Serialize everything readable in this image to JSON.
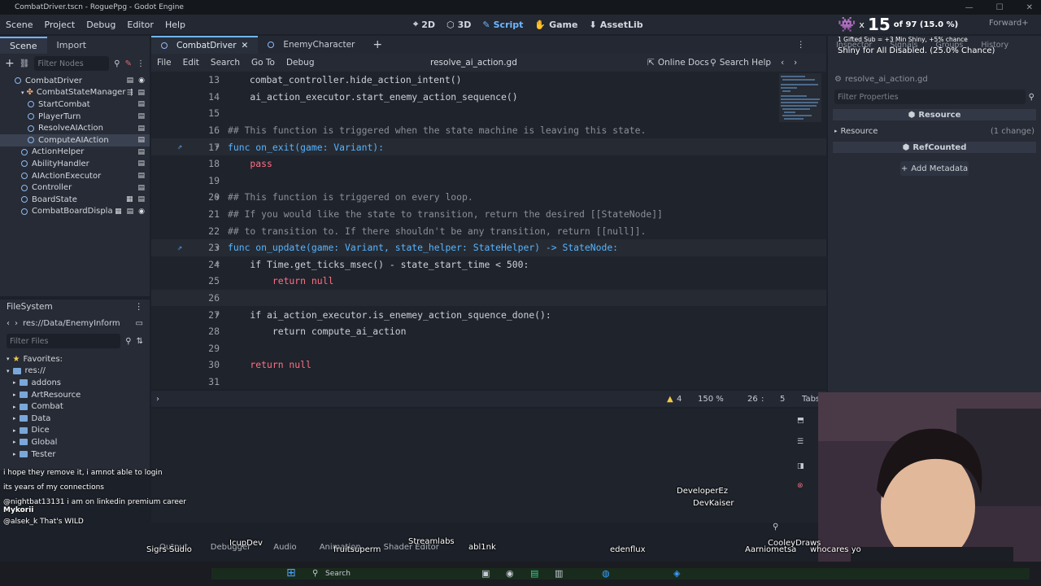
{
  "window": {
    "title": "CombatDriver.tscn - RoguePpg - Godot Engine"
  },
  "menubar": {
    "items": [
      "Scene",
      "Project",
      "Debug",
      "Editor",
      "Help"
    ],
    "modes": [
      "2D",
      "3D",
      "Script",
      "Game",
      "AssetLib"
    ],
    "renderer": "Forward+"
  },
  "scene_dock": {
    "tabs": [
      "Scene",
      "Import"
    ],
    "filter_placeholder": "Filter Nodes",
    "nodes": [
      {
        "label": "CombatDriver"
      },
      {
        "label": "CombatStateManager"
      },
      {
        "label": "StartCombat"
      },
      {
        "label": "PlayerTurn"
      },
      {
        "label": "ResolveAIAction"
      },
      {
        "label": "ComputeAIAction"
      },
      {
        "label": "ActionHelper"
      },
      {
        "label": "AbilityHandler"
      },
      {
        "label": "AIActionExecutor"
      },
      {
        "label": "Controller"
      },
      {
        "label": "BoardState"
      },
      {
        "label": "CombatBoardDispla"
      }
    ]
  },
  "filesystem": {
    "title": "FileSystem",
    "path": "res://Data/EnemyInform",
    "filter_placeholder": "Filter Files",
    "favorites_label": "Favorites:",
    "root": "res://",
    "folders": [
      "addons",
      "ArtResource",
      "Combat",
      "Data",
      "Dice",
      "Global",
      "Tester"
    ]
  },
  "editor": {
    "tabs": [
      "CombatDriver",
      "EnemyCharacter"
    ],
    "menu": [
      "File",
      "Edit",
      "Search",
      "Go To",
      "Debug"
    ],
    "script_name": "resolve_ai_action.gd",
    "online_docs": "Online Docs",
    "search_help": "Search Help",
    "lines": [
      {
        "n": "13",
        "text": "    combat_controller.hide_action_intent()"
      },
      {
        "n": "14",
        "text": "    ai_action_executor.start_enemy_action_sequence()"
      },
      {
        "n": "15",
        "text": ""
      },
      {
        "n": "16",
        "text": "## This function is triggered when the state machine is leaving this state."
      },
      {
        "n": "17",
        "text": "func on_exit(game: Variant):"
      },
      {
        "n": "18",
        "text": "    pass"
      },
      {
        "n": "19",
        "text": ""
      },
      {
        "n": "20",
        "text": "## This function is triggered on every loop."
      },
      {
        "n": "21",
        "text": "## If you would like the state to transition, return the desired [[StateNode]]"
      },
      {
        "n": "22",
        "text": "## to transition to. If there shouldn't be any transition, return [[null]]."
      },
      {
        "n": "23",
        "text": "func on_update(game: Variant, state_helper: StateHelper) -> StateNode:"
      },
      {
        "n": "24",
        "text": "    if Time.get_ticks_msec() - state_start_time < 500:"
      },
      {
        "n": "25",
        "text": "        return null"
      },
      {
        "n": "26",
        "text": ""
      },
      {
        "n": "27",
        "text": "    if ai_action_executor.is_enemey_action_squence_done():"
      },
      {
        "n": "28",
        "text": "        return compute_ai_action"
      },
      {
        "n": "29",
        "text": ""
      },
      {
        "n": "30",
        "text": "    return null"
      },
      {
        "n": "31",
        "text": ""
      }
    ],
    "status": {
      "warnings": "4",
      "zoom": "150 %",
      "line": "26",
      "col": "5",
      "indent": "Tabs"
    }
  },
  "inspector": {
    "tabs": [
      "Inspector",
      "Signals",
      "Groups",
      "History"
    ],
    "file": "resolve_ai_action.gd",
    "filter_placeholder": "Filter Properties",
    "resource_header": "Resource",
    "resource_section": "Resource",
    "changes": "(1 change)",
    "refcounted": "RefCounted",
    "add_metadata": "Add Metadata"
  },
  "stream_overlay": {
    "shiny_count": "15",
    "shiny_of": "of 97 (15.0 %)",
    "sub_note": "1 Gifted Sub = +3 Min Shiny, +5% chance",
    "shiny_status": "Shiny for All Disabled. (25.0% Chance)",
    "chat": [
      {
        "user": "",
        "text": "i hope they remove it, i amnot able to login"
      },
      {
        "user": "",
        "text": "its years of my connections"
      },
      {
        "user": "",
        "text": "@nightbat13131 i am on linkedin premium career"
      },
      {
        "user": "Mykorii",
        "text": ""
      },
      {
        "user": "",
        "text": "@alsek_k That's WILD"
      }
    ],
    "nicknames": [
      "DeveloperEz",
      "DevKaiser",
      "Streamlabs",
      "abl1nk",
      "edenflux",
      "fruitsuperm",
      "Aarniometsa",
      "CooleyDraws",
      "whocares yo",
      "Sigrs Sudio",
      "IcupDev"
    ]
  },
  "bottom_tabs": [
    "Output",
    "Debugger",
    "Audio",
    "Animation",
    "Shader Editor"
  ],
  "taskbar": {
    "search_placeholder": "Search"
  }
}
